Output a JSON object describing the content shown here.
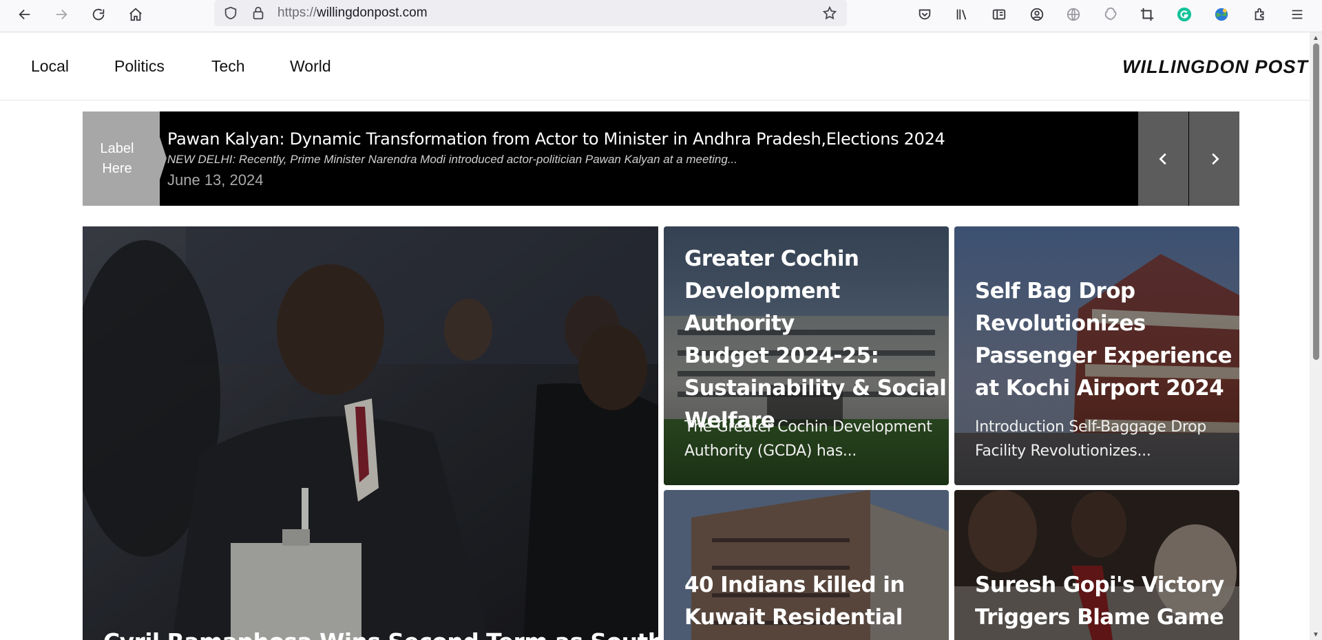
{
  "browser": {
    "url_protocol": "https://",
    "url_host": "willingdonpost.com",
    "icons": [
      "back-icon",
      "forward-icon",
      "reload-icon",
      "home-icon",
      "shield-icon",
      "lock-icon",
      "bookmark-star-icon",
      "pocket-icon",
      "library-icon",
      "reader-view-icon",
      "account-icon",
      "globe-icon",
      "extension-icon",
      "crop-icon",
      "grammarly-icon",
      "colorful-globe-icon",
      "puzzle-icon",
      "menu-icon"
    ]
  },
  "header": {
    "nav": [
      "Local",
      "Politics",
      "Tech",
      "World"
    ],
    "logo": "WILLINGDON POST"
  },
  "ticker": {
    "label_line1": "Label",
    "label_line2": "Here",
    "title": "Pawan Kalyan: Dynamic Transformation from Actor to Minister in Andhra Pradesh,Elections 2024",
    "excerpt": "NEW DELHI: Recently, Prime Minister Narendra Modi introduced actor-politician Pawan Kalyan at a meeting...",
    "date": "June 13, 2024"
  },
  "cards": {
    "main": {
      "title": "Cyril Ramaphosa Wins Second Term as South"
    },
    "gcda": {
      "title_lines": [
        "Greater Cochin",
        "Development Authority",
        "Budget 2024-25:",
        "Sustainability & Social",
        "Welfare"
      ],
      "excerpt_lines": [
        "The Greater Cochin Development",
        "Authority (GCDA) has..."
      ]
    },
    "airport": {
      "title_lines": [
        "Self Bag Drop",
        "Revolutionizes",
        "Passenger Experience",
        "at Kochi Airport 2024"
      ],
      "excerpt_lines": [
        "Introduction Self-Baggage Drop",
        "Facility Revolutionizes..."
      ]
    },
    "kuwait": {
      "title_lines": [
        "40 Indians killed in",
        "Kuwait Residential"
      ]
    },
    "gopi": {
      "title_lines": [
        "Suresh Gopi's Victory",
        "Triggers Blame Game in"
      ]
    }
  },
  "colors": {
    "ticker_bg": "#000000",
    "ticker_label_bg": "#a7a7a7",
    "ticker_nav_bg": "#5c5c5c"
  }
}
